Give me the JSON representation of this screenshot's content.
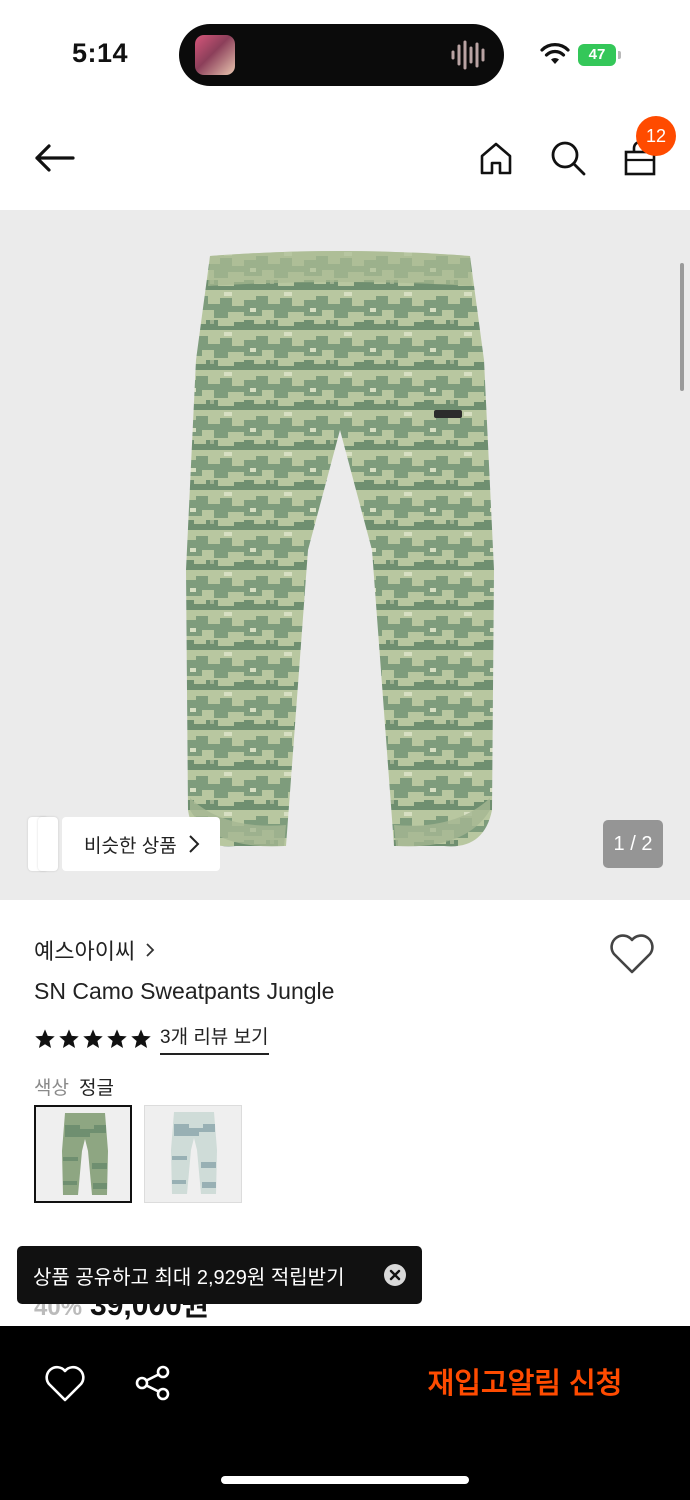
{
  "status_bar": {
    "time": "5:14",
    "battery_level": "47",
    "icons": [
      "wifi-icon",
      "battery-icon",
      "audio-wave-icon"
    ]
  },
  "nav": {
    "icons": [
      "back-arrow-icon",
      "home-icon",
      "search-icon",
      "shopping-bag-icon"
    ],
    "cart_count": "12"
  },
  "gallery": {
    "similar_label": "비슷한 상품",
    "page_indicator": "1 / 2"
  },
  "product": {
    "brand": "예스아이씨",
    "name": "SN Camo Sweatpants Jungle",
    "rating_stars": 5,
    "review_link": "3개 리뷰 보기",
    "color_label": "색상",
    "color_value": "정글",
    "price_partial": "39,000원",
    "discount_partial": "40%"
  },
  "toast": {
    "text": "상품 공유하고 최대 2,929원 적립받기"
  },
  "bottom_bar": {
    "restock_label": "재입고알림 신청"
  },
  "colors": {
    "accent": "#ff4b00",
    "camo_light": "#b8c7a0",
    "camo_dark": "#6f8f70",
    "camo_alt_light": "#cfdcd8",
    "camo_alt_dark": "#98b0b4"
  }
}
